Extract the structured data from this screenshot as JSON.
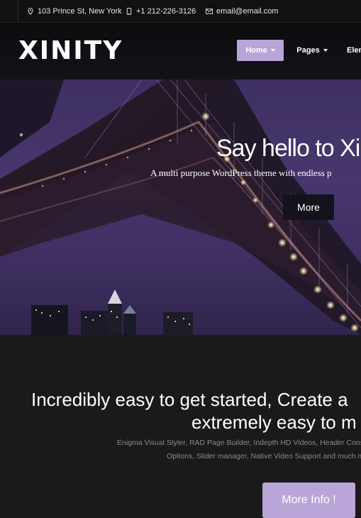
{
  "topbar": {
    "address": "103 Prince St, New York",
    "phone": "+1 212-226-3126",
    "email": "email@email.com",
    "icons": [
      "location-pin-icon",
      "phone-icon",
      "envelope-icon"
    ]
  },
  "header": {
    "logo": "XINITY",
    "nav": [
      {
        "label": "Home",
        "active": true
      },
      {
        "label": "Pages",
        "active": false
      },
      {
        "label": "Elem",
        "active": false
      }
    ]
  },
  "hero": {
    "title": "Say hello to Xi",
    "subtitle": "A multi purpose WordPress theme with endless p",
    "button": "More"
  },
  "content": {
    "heading_line1": "Incredibly easy to get started, Create a",
    "heading_line2": "extremely easy to m",
    "text_line1": "Enigma Visual Styler, RAD Page Builder, Indepth HD Videos, Header Constru",
    "text_line2": "Options, Slider manager, Native Video Support and much muc",
    "button": "More Info !"
  },
  "colors": {
    "accent": "#b9a5d8",
    "topbar_bg": "#111111",
    "content_bg": "#1a1a1a",
    "hero_btn_bg": "#14121c"
  }
}
